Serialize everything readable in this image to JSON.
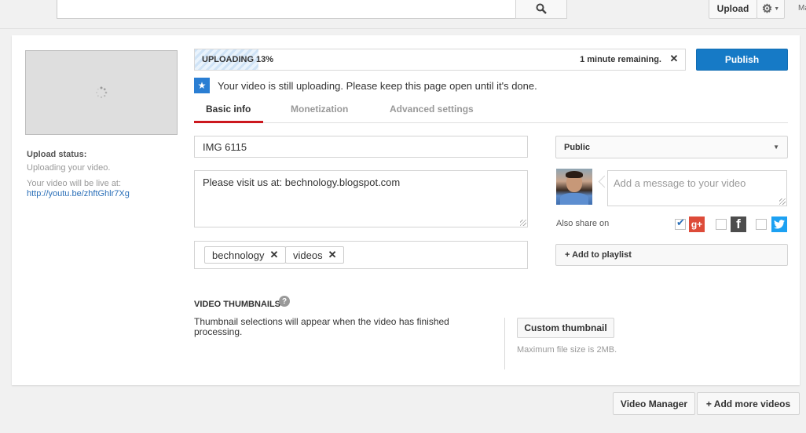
{
  "topbar": {
    "upload_label": "Upload",
    "search_icon": "search-icon",
    "gear_icon": "gear-icon",
    "account_text": "Ma"
  },
  "sidebar": {
    "upload_status_title": "Upload status:",
    "upload_status_text": "Uploading your video.",
    "live_text": "Your video will be live at:",
    "live_url": "http://youtu.be/zhftGhlr7Xg"
  },
  "progress": {
    "label": "UPLOADING 13%",
    "percent": 13,
    "remaining": "1 minute remaining.",
    "close_icon": "close-icon"
  },
  "publish_label": "Publish",
  "notice": {
    "text": "Your video is still uploading. Please keep this page open until it's done."
  },
  "tabs": [
    {
      "label": "Basic info",
      "active": true
    },
    {
      "label": "Monetization",
      "active": false
    },
    {
      "label": "Advanced settings",
      "active": false
    }
  ],
  "form": {
    "title_value": "IMG 6115",
    "description_value": "Please visit us at: bechnology.blogspot.com",
    "tags": [
      "bechnology",
      "videos"
    ],
    "privacy_value": "Public",
    "message_placeholder": "Add a message to your video",
    "also_share_label": "Also share on",
    "share_targets": [
      {
        "name": "Google+",
        "icon": "google-plus-icon",
        "checked": true,
        "color": "#dd4b39"
      },
      {
        "name": "Facebook",
        "icon": "facebook-icon",
        "checked": false,
        "color": "#3b5998"
      },
      {
        "name": "Twitter",
        "icon": "twitter-icon",
        "checked": false,
        "color": "#1da1f2"
      }
    ],
    "add_to_playlist_label": "+ Add to playlist"
  },
  "thumbnails": {
    "heading": "VIDEO THUMBNAILS",
    "message": "Thumbnail selections will appear when the video has finished processing.",
    "custom_button": "Custom thumbnail",
    "max_size": "Maximum file size is 2MB."
  },
  "footer": {
    "video_manager_label": "Video Manager",
    "add_more_label": "+ Add more videos"
  },
  "colors": {
    "accent": "#167ac6",
    "active_tab": "#cc181e"
  }
}
